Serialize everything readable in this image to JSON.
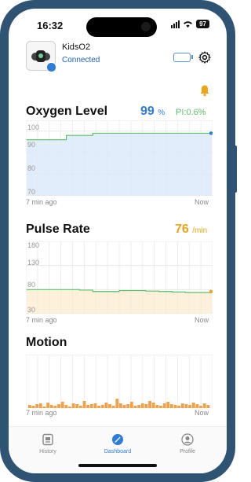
{
  "status_bar": {
    "time": "16:32",
    "battery": "97"
  },
  "device": {
    "name": "KidsO2",
    "status": "Connected"
  },
  "oxygen": {
    "title": "Oxygen Level",
    "value": "99",
    "unit": "%",
    "pi": "PI:0.6%",
    "yticks": [
      "100",
      "90",
      "80",
      "70"
    ],
    "time_start": "7 min ago",
    "time_end": "Now",
    "color": "#2f7bd8",
    "line_color": "#5fbf6a"
  },
  "pulse": {
    "title": "Pulse Rate",
    "value": "76",
    "unit": "/min",
    "yticks": [
      "180",
      "130",
      "80",
      "30"
    ],
    "time_start": "7 min ago",
    "time_end": "Now",
    "color": "#f2a219"
  },
  "motion": {
    "title": "Motion",
    "time_start": "7 min ago",
    "time_end": "Now",
    "bar_color": "#f2a14a"
  },
  "tabs": [
    {
      "label": "History",
      "icon": "history-icon",
      "active": false
    },
    {
      "label": "Dashboard",
      "icon": "dashboard-icon",
      "active": true
    },
    {
      "label": "Profile",
      "icon": "profile-icon",
      "active": false
    }
  ],
  "chart_data": [
    {
      "type": "line",
      "ylabel": "",
      "ylim": [
        70,
        105
      ],
      "yticks": [
        100,
        90,
        80,
        70
      ],
      "x": [
        0,
        0.5,
        1,
        1.5,
        2,
        2.5,
        3,
        3.5,
        4,
        4.5,
        5,
        5.5,
        6,
        6.5,
        7
      ],
      "series": [
        {
          "values": [
            96,
            96,
            96,
            98,
            98,
            99,
            99,
            99,
            99,
            99,
            99,
            99,
            99,
            99,
            99
          ]
        }
      ]
    },
    {
      "type": "line",
      "ylabel": "",
      "ylim": [
        30,
        180
      ],
      "yticks": [
        180,
        130,
        80,
        30
      ],
      "x": [
        0,
        0.5,
        1,
        1.5,
        2,
        2.5,
        3,
        3.5,
        4,
        4.5,
        5,
        5.5,
        6,
        6.5,
        7
      ],
      "series": [
        {
          "values": [
            80,
            80,
            80,
            80,
            79,
            76,
            76,
            78,
            78,
            77,
            76,
            75,
            74,
            74,
            76
          ]
        }
      ]
    },
    {
      "type": "bar",
      "values": [
        0,
        0,
        0,
        0,
        0,
        0,
        0,
        0,
        0,
        0,
        0,
        0,
        0,
        0,
        0,
        0,
        0,
        0,
        0,
        0,
        0,
        0,
        0,
        0,
        0,
        0,
        0,
        0,
        0,
        0,
        0,
        0,
        0,
        0,
        0,
        0,
        0,
        0,
        0,
        0,
        0,
        0,
        0,
        0,
        0,
        0,
        0,
        0,
        0,
        0,
        0,
        0,
        0,
        0,
        0,
        0,
        0,
        0,
        0,
        0,
        0,
        0,
        0,
        0,
        0,
        0,
        0,
        0,
        0,
        0,
        0,
        0,
        0,
        0,
        0,
        0,
        0,
        0,
        0,
        0,
        0,
        0,
        0,
        0,
        0,
        0,
        0,
        0,
        0,
        0,
        0,
        0,
        0,
        0,
        0,
        0,
        0,
        0,
        0,
        0,
        0,
        0,
        0,
        0,
        0,
        0,
        0,
        0,
        0,
        0,
        0,
        0,
        0,
        0,
        0,
        0,
        0,
        0,
        0,
        0,
        0,
        0,
        0,
        0,
        0,
        0,
        0,
        0,
        0,
        0,
        0,
        0,
        0,
        0,
        0,
        0,
        0,
        0,
        0,
        0,
        0,
        0,
        0,
        0,
        0,
        0,
        0,
        0,
        0,
        0,
        0,
        0,
        0,
        0,
        0,
        0,
        0,
        0,
        0,
        0,
        0,
        0,
        0,
        0,
        0,
        0,
        0,
        0,
        0,
        0,
        0,
        0,
        0,
        0,
        0,
        0,
        0,
        0,
        0,
        0,
        0,
        0,
        0,
        0,
        0,
        0,
        0,
        0,
        0,
        0,
        0,
        0,
        0,
        0,
        0,
        0,
        0,
        0,
        0,
        0
      ]
    }
  ]
}
